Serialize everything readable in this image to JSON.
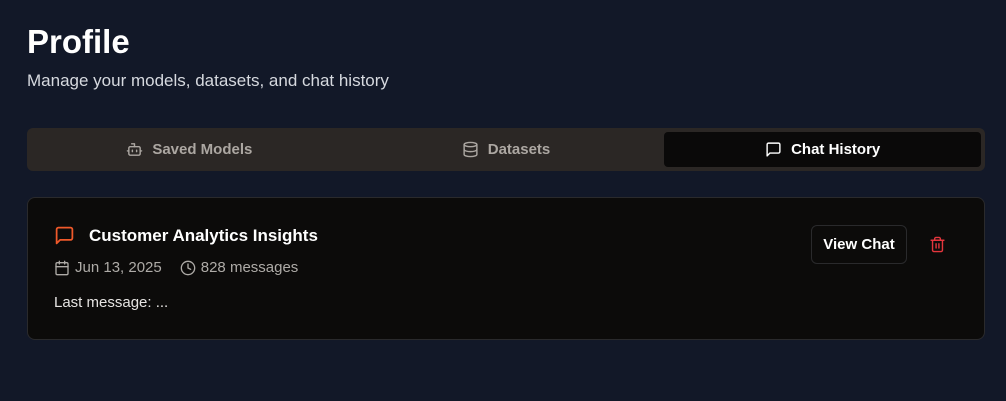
{
  "header": {
    "title": "Profile",
    "subtitle": "Manage your models, datasets, and chat history"
  },
  "tabs": [
    {
      "label": "Saved Models",
      "icon": "bot-icon",
      "active": false
    },
    {
      "label": "Datasets",
      "icon": "database-icon",
      "active": false
    },
    {
      "label": "Chat History",
      "icon": "message-square-icon",
      "active": true
    }
  ],
  "chat": {
    "title": "Customer Analytics Insights",
    "icon": "message-square-icon",
    "date": "Jun 13, 2025",
    "messages": "828 messages",
    "last_message": "Last message: ...",
    "view_label": "View Chat",
    "delete_icon": "trash-icon"
  },
  "colors": {
    "background": "#121828",
    "accent": "#f0592a",
    "danger": "#e5363d",
    "active_tab": "#0a0909",
    "tab_bar": "#2b2725"
  }
}
